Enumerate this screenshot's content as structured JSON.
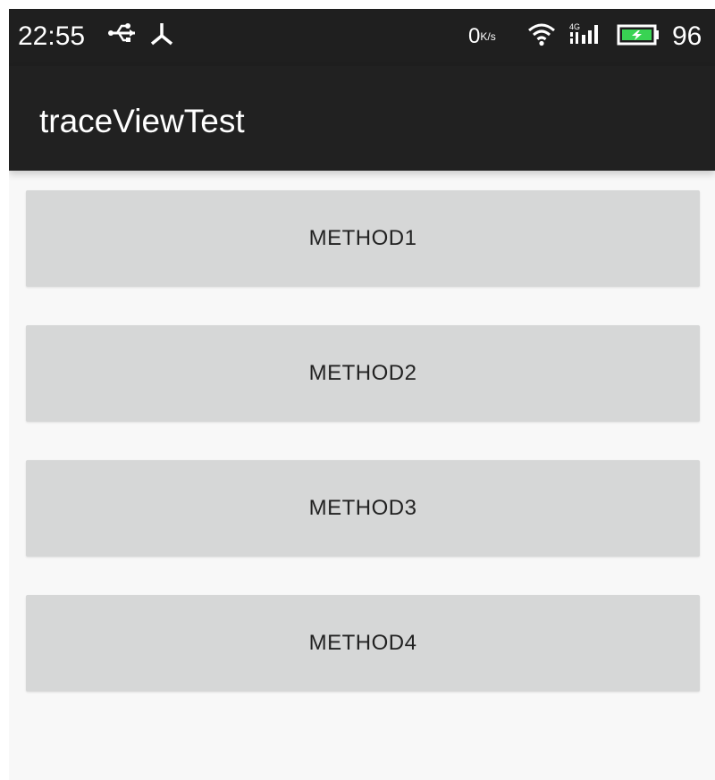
{
  "status_bar": {
    "time": "22:55",
    "left_icons": [
      "usb-icon",
      "usb-debug-icon"
    ],
    "net_speed_value": "0",
    "net_speed_unit": "K/s",
    "right_icons": [
      "wifi-icon",
      "signal-4g-icon",
      "battery-icon"
    ],
    "battery_percent": "96",
    "battery_color": "#39d353"
  },
  "app_bar": {
    "title": "traceViewTest"
  },
  "buttons": [
    {
      "label": "METHOD1"
    },
    {
      "label": "METHOD2"
    },
    {
      "label": "METHOD3"
    },
    {
      "label": "METHOD4"
    }
  ],
  "colors": {
    "status_bar_bg": "#1f1f1f",
    "app_bar_bg": "#212121",
    "content_bg": "#f8f8f8",
    "button_bg": "#d6d7d7"
  }
}
